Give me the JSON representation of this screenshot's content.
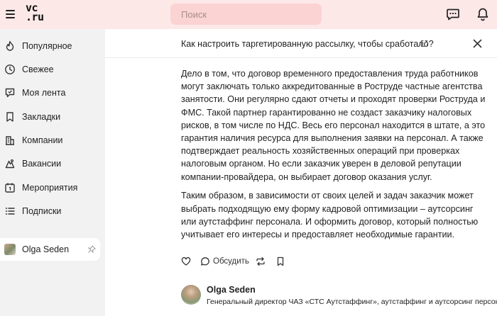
{
  "header": {
    "logo_line1": "vc",
    "logo_line2": ".ru",
    "search_placeholder": "Поиск"
  },
  "sidebar": {
    "items": [
      {
        "label": "Популярное",
        "icon": "flame-icon"
      },
      {
        "label": "Свежее",
        "icon": "clock-icon"
      },
      {
        "label": "Моя лента",
        "icon": "feed-icon"
      },
      {
        "label": "Закладки",
        "icon": "bookmark-icon"
      },
      {
        "label": "Компании",
        "icon": "building-icon"
      },
      {
        "label": "Вакансии",
        "icon": "briefcase-icon"
      },
      {
        "label": "Мероприятия",
        "icon": "calendar-icon"
      },
      {
        "label": "Подписки",
        "icon": "list-icon"
      }
    ],
    "user": {
      "name": "Olga Seden"
    }
  },
  "topbar": {
    "title": "Как настроить таргетированную рассылку, чтобы сработало?"
  },
  "article": {
    "paragraphs": [
      "Дело в том, что договор временного предоставления труда работников могут заключать только аккредитованные в Роструде частные агентства занятости. Они регулярно сдают отчеты и проходят проверки Роструда и ФМС. Такой партнер гарантированно не создаст заказчику налоговых рисков, в том числе по НДС. Весь его персонал находится в штате, а это гарантия наличия ресурса для выполнения заявки на персонал. А также подтверждает реальность хозяйственных операций при проверках налоговым органом. Но если заказчик уверен в деловой репутации компании-провайдера, он выбирает договор оказания услуг.",
      "Таким образом, в зависимости от своих целей и задач заказчик может выбрать подходящую ему форму кадровой оптимизации – аутсорсинг или аутстаффинг персонала. И оформить договор, который полностью учитывает его интересы и предоставляет необходимые гарантии."
    ]
  },
  "actions": {
    "comment_label": "Обсудить"
  },
  "author": {
    "name": "Olga Seden",
    "role": "Генеральный директор ЧАЗ «СТС Аутстаффинг», аутстаффинг и аутсорсинг персонала"
  },
  "colors": {
    "header_bg": "#fde8e8",
    "search_bg": "#fbd3d3",
    "page_bg": "#f2f2f2",
    "panel_bg": "#ffffff"
  }
}
